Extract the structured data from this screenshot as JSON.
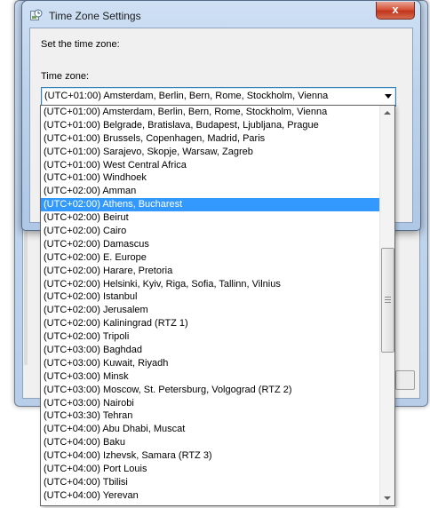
{
  "dialog": {
    "title": "Time Zone Settings",
    "close_label": "x",
    "prompt": "Set the time zone:",
    "time_zone_label": "Time zone:",
    "selected_value": "(UTC+01:00) Amsterdam, Berlin, Bern, Rome, Stockholm, Vienna"
  },
  "dropdown": {
    "highlighted_index": 7,
    "items": [
      "(UTC+01:00) Amsterdam, Berlin, Bern, Rome, Stockholm, Vienna",
      "(UTC+01:00) Belgrade, Bratislava, Budapest, Ljubljana, Prague",
      "(UTC+01:00) Brussels, Copenhagen, Madrid, Paris",
      "(UTC+01:00) Sarajevo, Skopje, Warsaw, Zagreb",
      "(UTC+01:00) West Central Africa",
      "(UTC+01:00) Windhoek",
      "(UTC+02:00) Amman",
      "(UTC+02:00) Athens, Bucharest",
      "(UTC+02:00) Beirut",
      "(UTC+02:00) Cairo",
      "(UTC+02:00) Damascus",
      "(UTC+02:00) E. Europe",
      "(UTC+02:00) Harare, Pretoria",
      "(UTC+02:00) Helsinki, Kyiv, Riga, Sofia, Tallinn, Vilnius",
      "(UTC+02:00) Istanbul",
      "(UTC+02:00) Jerusalem",
      "(UTC+02:00) Kaliningrad (RTZ 1)",
      "(UTC+02:00) Tripoli",
      "(UTC+03:00) Baghdad",
      "(UTC+03:00) Kuwait, Riyadh",
      "(UTC+03:00) Minsk",
      "(UTC+03:00) Moscow, St. Petersburg, Volgograd (RTZ 2)",
      "(UTC+03:00) Nairobi",
      "(UTC+03:30) Tehran",
      "(UTC+04:00) Abu Dhabi, Muscat",
      "(UTC+04:00) Baku",
      "(UTC+04:00) Izhevsk, Samara (RTZ 3)",
      "(UTC+04:00) Port Louis",
      "(UTC+04:00) Tbilisi",
      "(UTC+04:00) Yerevan"
    ]
  },
  "colors": {
    "selection": "#3399ff",
    "close_button": "#c1361c",
    "title_bar": "#bcd2ec"
  },
  "icons": {
    "app": "clock-globe-icon",
    "combo": "chevron-down-icon",
    "scroll_up": "scroll-up-arrow-icon",
    "scroll_down": "scroll-down-arrow-icon"
  }
}
